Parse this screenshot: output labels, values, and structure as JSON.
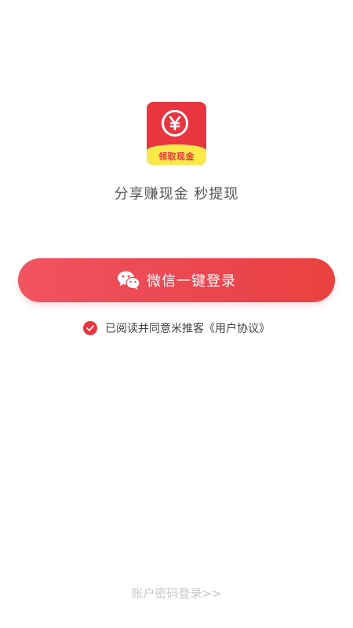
{
  "brand": {
    "logo_symbol": "¥",
    "logo_banner_text": "领取现金",
    "logo_color": "#e8353f",
    "banner_color": "#fbe94a"
  },
  "slogan": "分享赚现金  秒提现",
  "login": {
    "wechat_button_label": "微信一键登录",
    "wechat_icon": "wechat-icon",
    "accent_color": "#eb4650"
  },
  "agreement": {
    "checked": true,
    "text": "已阅读并同意米推客《用户协议》"
  },
  "footer": {
    "account_login_link": "账户密码登录>>"
  }
}
